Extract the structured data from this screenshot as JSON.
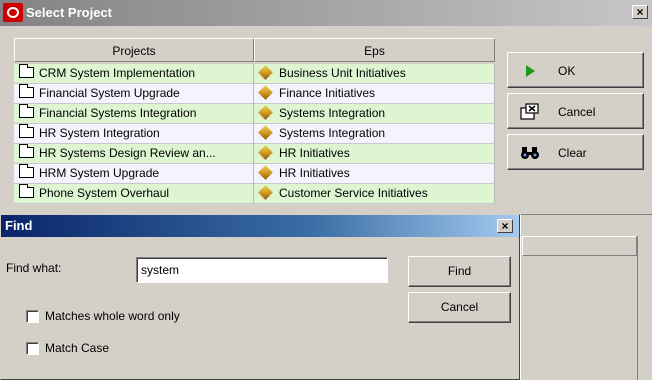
{
  "select_project": {
    "title": "Select Project",
    "close_glyph": "×",
    "columns": [
      "Projects",
      "Eps"
    ],
    "rows": [
      {
        "project": "CRM System Implementation",
        "eps": "Business Unit Initiatives"
      },
      {
        "project": "Financial System Upgrade",
        "eps": "Finance Initiatives"
      },
      {
        "project": "Financial Systems Integration",
        "eps": "Systems Integration"
      },
      {
        "project": "HR System Integration",
        "eps": "Systems Integration"
      },
      {
        "project": "HR Systems Design Review an...",
        "eps": "HR Initiatives"
      },
      {
        "project": "HRM System Upgrade",
        "eps": "HR Initiatives"
      },
      {
        "project": "Phone System Overhaul",
        "eps": "Customer Service Initiatives"
      }
    ],
    "buttons": {
      "ok": "OK",
      "cancel": "Cancel",
      "clear": "Clear"
    },
    "icons": {
      "ok": "play-triangle-icon",
      "cancel": "close-window-icon",
      "clear": "binoculars-icon",
      "app": "oracle-logo-icon",
      "row_project": "folder-icon",
      "row_eps": "eps-diamond-icon"
    },
    "colors": {
      "row_green": "#ddf5d0",
      "row_white": "#f4f4ff",
      "ok_icon": "#1a9a1a"
    }
  },
  "find_dialog": {
    "title": "Find",
    "close_glyph": "×",
    "find_what_label": "Find what:",
    "find_what_value": "system",
    "find_button": "Find",
    "cancel_button": "Cancel",
    "matches_whole_word_label": "Matches whole word only",
    "matches_whole_word_checked": false,
    "match_case_label": "Match Case",
    "match_case_checked": false,
    "colors": {
      "titlebar_start": "#0a246a",
      "titlebar_end": "#a6caf0"
    }
  }
}
